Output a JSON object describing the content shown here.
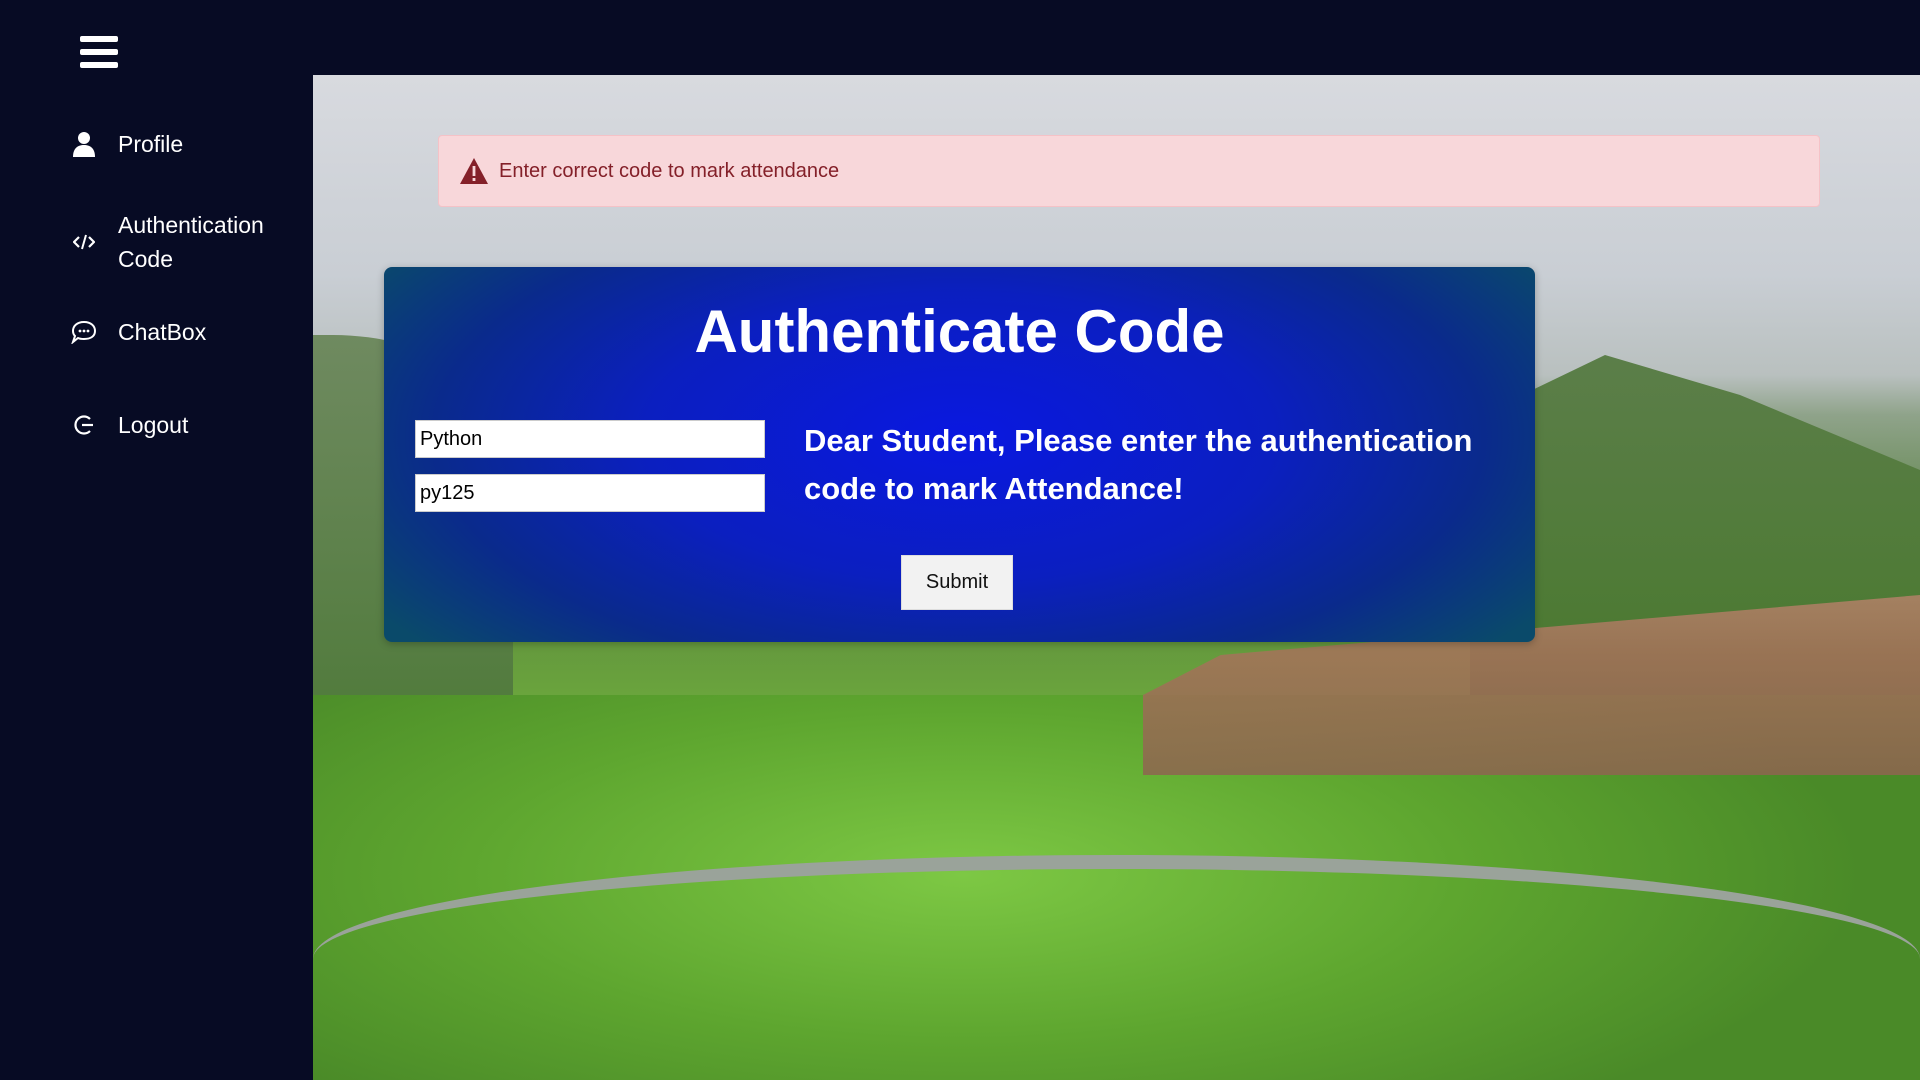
{
  "header": {
    "menu_icon": "hamburger-menu-icon"
  },
  "sidebar": {
    "items": [
      {
        "label": "Profile",
        "icon": "user-icon"
      },
      {
        "label": "Authentication Code",
        "icon": "code-icon"
      },
      {
        "label": "ChatBox",
        "icon": "chat-bubble-icon"
      },
      {
        "label": "Logout",
        "icon": "logout-icon"
      }
    ]
  },
  "alert": {
    "icon": "warning-triangle-icon",
    "message": "Enter correct code to mark attendance",
    "color": "#842029",
    "background": "#f8d7da"
  },
  "auth_form": {
    "title": "Authenticate Code",
    "course_value": "Python",
    "code_value": "py125",
    "message": "Dear Student, Please enter the authentication code to mark Attendance!",
    "submit_label": "Submit"
  },
  "theme": {
    "sidebar_background": "#070b24",
    "card_gradient_center": "#0a18e0"
  }
}
